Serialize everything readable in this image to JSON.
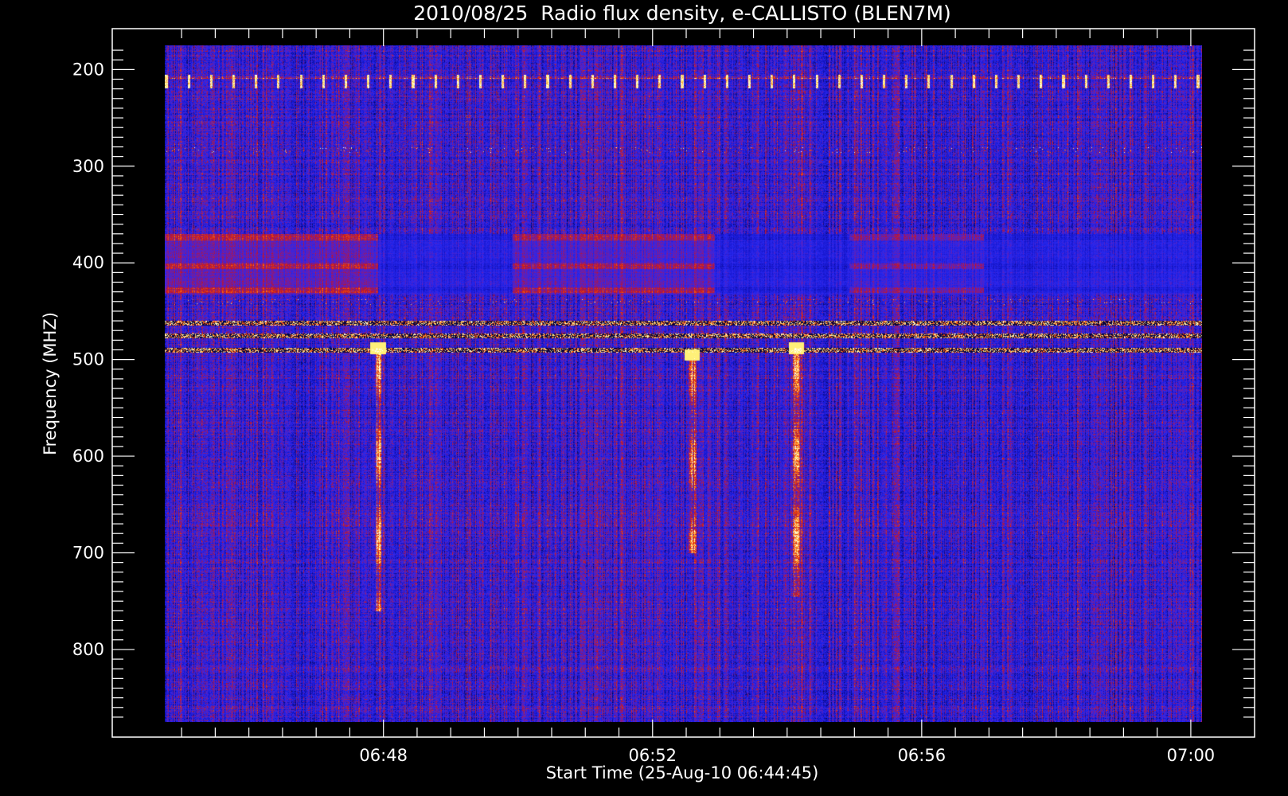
{
  "chart_data": {
    "type": "heatmap",
    "title": "2010/08/25  Radio flux density, e-CALLISTO (BLEN7M)",
    "xlabel": "Start Time (25-Aug-10 06:44:45)",
    "ylabel": "Frequency (MHZ)",
    "x_range": [
      "06:44:45",
      "07:00:10"
    ],
    "y_range": [
      175,
      875
    ],
    "y_axis_inverted": true,
    "x_ticks": [
      "06:48",
      "06:52",
      "06:56",
      "07:00"
    ],
    "y_ticks": [
      "200",
      "300",
      "400",
      "500",
      "600",
      "700",
      "800"
    ],
    "colormap": [
      "#000000",
      "#1010cc",
      "#2a2aff",
      "#c01818",
      "#ff6a00",
      "#ffff99",
      "#ffffff"
    ],
    "background_color": "#2020e0",
    "features": [
      {
        "type": "periodic-spikes",
        "freq_mhz": 212,
        "period_s": 20
      },
      {
        "type": "interference-band",
        "freq_mhz": 462
      },
      {
        "type": "interference-band",
        "freq_mhz": 475
      },
      {
        "type": "interference-band",
        "freq_mhz": 490
      },
      {
        "type": "burst",
        "time": "06:54:08",
        "freq_start_mhz": 488,
        "freq_end_mhz": 745
      },
      {
        "type": "burst",
        "time": "06:47:55",
        "freq_start_mhz": 488,
        "freq_end_mhz": 760
      },
      {
        "type": "burst",
        "time": "06:52:35",
        "freq_start_mhz": 495,
        "freq_end_mhz": 700
      }
    ]
  }
}
